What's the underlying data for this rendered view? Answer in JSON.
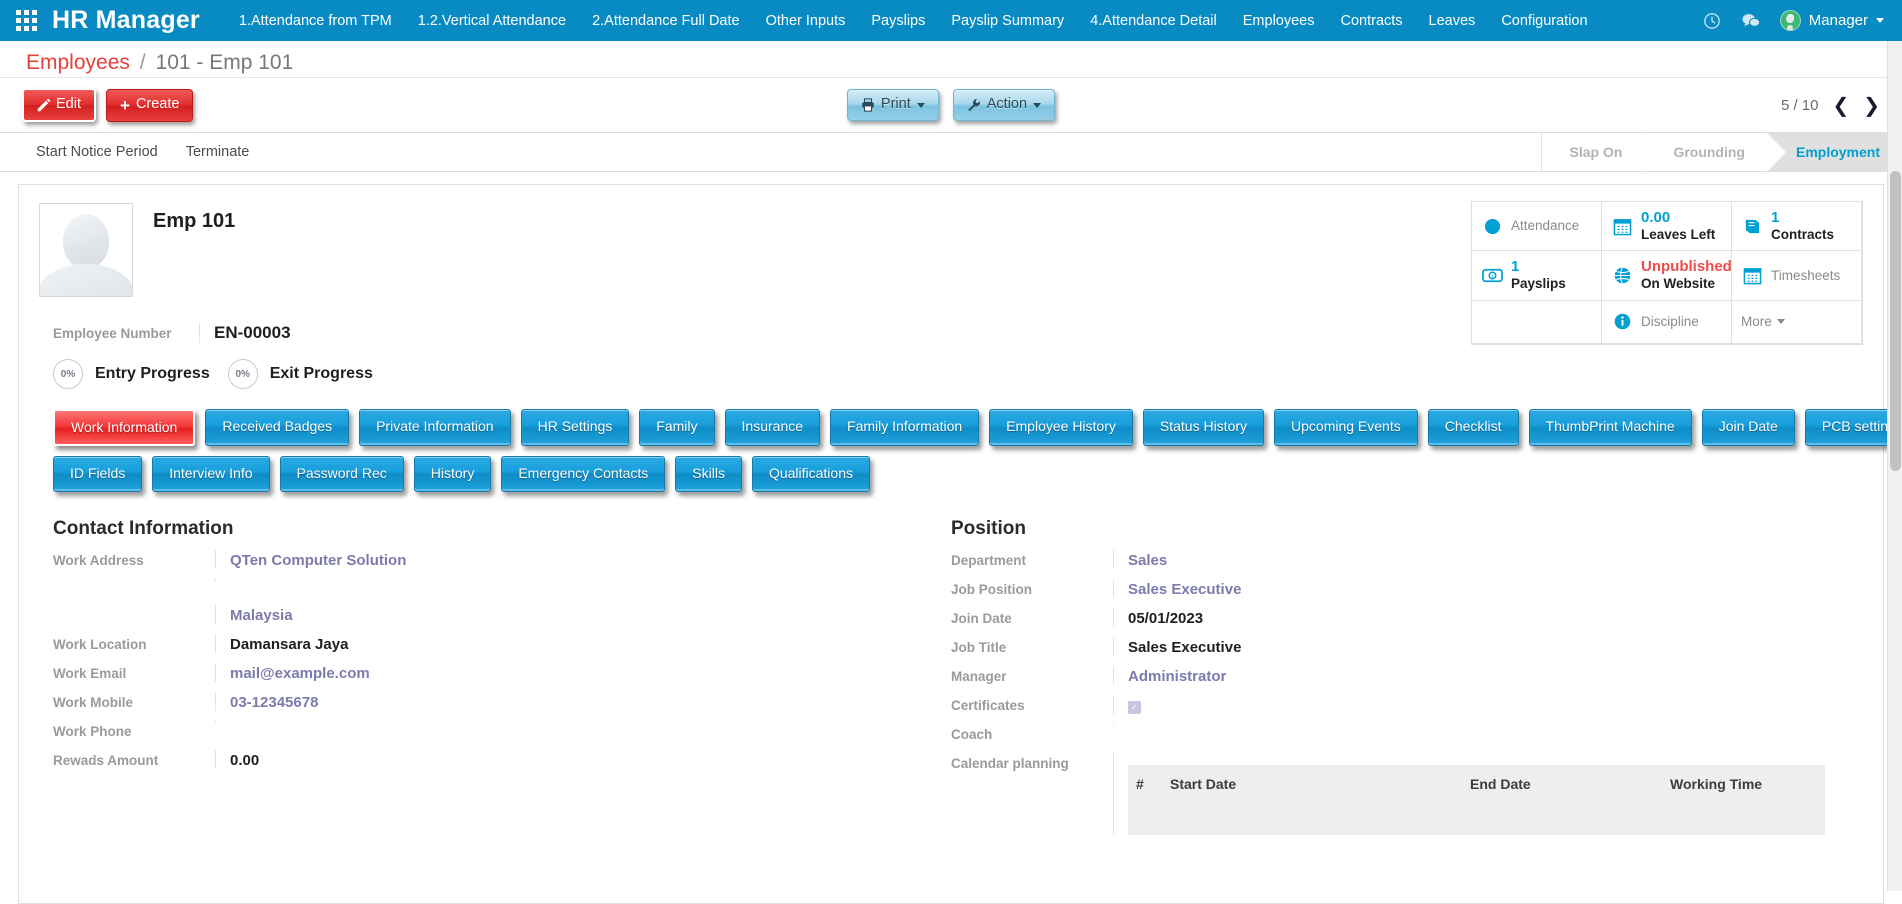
{
  "navbar": {
    "apps_icon": "apps-grid-icon",
    "brand": "HR Manager",
    "menu": [
      "1.Attendance from TPM",
      "1.2.Vertical Attendance",
      "2.Attendance Full Date",
      "Other Inputs",
      "Payslips",
      "Payslip Summary",
      "4.Attendance Detail",
      "Employees",
      "Contracts",
      "Leaves",
      "Configuration"
    ],
    "icons": [
      "clock-icon",
      "chat-icon"
    ],
    "user": "Manager"
  },
  "breadcrumb": {
    "root": "Employees",
    "separator": "/",
    "current": "101 - Emp 101"
  },
  "control_panel": {
    "edit": "Edit",
    "create": "Create",
    "print": "Print",
    "action": "Action",
    "pager": "5 / 10"
  },
  "statusbar": {
    "buttons": [
      "Start Notice Period",
      "Terminate"
    ],
    "steps": [
      {
        "label": "Slap On",
        "active": false
      },
      {
        "label": "Grounding",
        "active": false
      },
      {
        "label": "Employment",
        "active": true
      }
    ]
  },
  "employee": {
    "name": "Emp 101",
    "number_label": "Employee Number",
    "number_value": "EN-00003"
  },
  "stats": [
    {
      "icon": "circle-icon",
      "value": "",
      "label": "Attendance",
      "label_bold": false,
      "value_color": ""
    },
    {
      "icon": "calendar-icon",
      "value": "0.00",
      "label": "Leaves Left",
      "label_bold": true,
      "value_color": "#00a0d2"
    },
    {
      "icon": "book-icon",
      "value": "1",
      "label": "Contracts",
      "label_bold": true,
      "value_color": "#00a0d2"
    },
    {
      "icon": "money-icon",
      "value": "1",
      "label": "Payslips",
      "label_bold": true,
      "value_color": "#00a0d2"
    },
    {
      "icon": "globe-icon",
      "value": "Unpublished",
      "label": "On Website",
      "label_bold": true,
      "value_color": "#ef4b4b"
    },
    {
      "icon": "calendar-icon",
      "value": "",
      "label": "Timesheets",
      "label_bold": false,
      "value_color": ""
    },
    {
      "icon": "info-icon",
      "value": "",
      "label": "Discipline",
      "label_bold": false,
      "value_color": ""
    },
    {
      "icon": "",
      "value": "",
      "label": "More",
      "label_bold": false,
      "value_color": ""
    }
  ],
  "progress": [
    {
      "pct": "0%",
      "label": "Entry Progress"
    },
    {
      "pct": "0%",
      "label": "Exit Progress"
    }
  ],
  "tabs_row1": [
    {
      "label": "Work Information",
      "active": true
    },
    {
      "label": "Received Badges",
      "active": false
    },
    {
      "label": "Private Information",
      "active": false
    },
    {
      "label": "HR Settings",
      "active": false
    },
    {
      "label": "Family",
      "active": false
    },
    {
      "label": "Insurance",
      "active": false
    },
    {
      "label": "Family Information",
      "active": false
    },
    {
      "label": "Employee History",
      "active": false
    },
    {
      "label": "Status History",
      "active": false
    },
    {
      "label": "Upcoming Events",
      "active": false
    },
    {
      "label": "Checklist",
      "active": false
    },
    {
      "label": "ThumbPrint Machine",
      "active": false
    },
    {
      "label": "Join Date",
      "active": false
    },
    {
      "label": "PCB settings",
      "active": false
    }
  ],
  "tabs_row2": [
    {
      "label": "ID Fields",
      "active": false
    },
    {
      "label": "Interview Info",
      "active": false
    },
    {
      "label": "Password Rec",
      "active": false
    },
    {
      "label": "History",
      "active": false
    },
    {
      "label": "Emergency Contacts",
      "active": false
    },
    {
      "label": "Skills",
      "active": false
    },
    {
      "label": "Qualifications",
      "active": false
    }
  ],
  "contact": {
    "title": "Contact Information",
    "fields": [
      {
        "label": "Work Address",
        "value": "QTen Computer Solution",
        "style": "link"
      },
      {
        "label": "",
        "value": "",
        "style": "blank"
      },
      {
        "label": "",
        "value": "Malaysia",
        "style": "link"
      },
      {
        "label": "Work Location",
        "value": "Damansara Jaya",
        "style": "bold"
      },
      {
        "label": "Work Email",
        "value": "mail@example.com",
        "style": "link"
      },
      {
        "label": "Work Mobile",
        "value": "03-12345678",
        "style": "link"
      },
      {
        "label": "Work Phone",
        "value": "",
        "style": "plain"
      },
      {
        "label": "Rewads Amount",
        "value": "0.00",
        "style": "bold"
      }
    ]
  },
  "position": {
    "title": "Position",
    "fields": [
      {
        "label": "Department",
        "value": "Sales",
        "style": "link"
      },
      {
        "label": "Job Position",
        "value": "Sales Executive",
        "style": "link"
      },
      {
        "label": "Join Date",
        "value": "05/01/2023",
        "style": "bold"
      },
      {
        "label": "Job Title",
        "value": "Sales Executive",
        "style": "bold"
      },
      {
        "label": "Manager",
        "value": "Administrator",
        "style": "link"
      },
      {
        "label": "Certificates",
        "value": "",
        "style": "checkbox"
      },
      {
        "label": "Coach",
        "value": "",
        "style": "plain"
      },
      {
        "label": "Calendar planning",
        "value": "",
        "style": "plain"
      }
    ],
    "table": {
      "columns": [
        "#",
        "Start Date",
        "End Date",
        "Working Time"
      ],
      "rows": []
    }
  },
  "colors": {
    "brand_blue": "#088bc2",
    "accent_red": "#e8403a",
    "link_purple": "#7c7bad",
    "stat_blue": "#00a0d2"
  }
}
